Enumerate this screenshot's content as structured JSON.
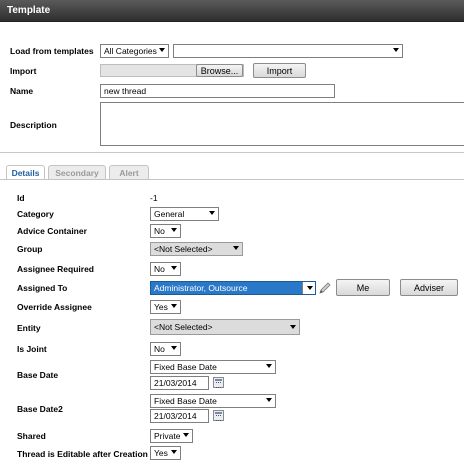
{
  "window": {
    "title": "Template"
  },
  "template": {
    "load_label": "Load from templates",
    "category_value": "All Categories",
    "template_value": "",
    "import_label": "Import",
    "browse_label": "Browse...",
    "import_button": "Import",
    "name_label": "Name",
    "name_value": "new thread",
    "description_label": "Description",
    "description_value": ""
  },
  "tabs": [
    {
      "label": "Details",
      "active": true
    },
    {
      "label": "Secondary",
      "active": false
    },
    {
      "label": "Alert",
      "active": false
    }
  ],
  "details": {
    "id_label": "Id",
    "id_value": "-1",
    "category_label": "Category",
    "category_value": "General",
    "advice_label": "Advice Container",
    "advice_value": "No",
    "group_label": "Group",
    "group_value": "<Not Selected>",
    "assignee_req_label": "Assignee Required",
    "assignee_req_value": "No",
    "assigned_to_label": "Assigned To",
    "assigned_to_value": "Administrator, Outsource",
    "me_button": "Me",
    "adviser_button": "Adviser",
    "override_label": "Override Assignee",
    "override_value": "Yes",
    "entity_label": "Entity",
    "entity_value": "<Not Selected>",
    "joint_label": "Is Joint",
    "joint_value": "No",
    "base_date_label": "Base Date",
    "base_date_type": "Fixed Base Date",
    "base_date_value": "21/03/2014",
    "base_date2_label": "Base Date2",
    "base_date2_type": "Fixed Base Date",
    "base_date2_value": "21/03/2014",
    "shared_label": "Shared",
    "shared_value": "Private",
    "editable_label": "Thread is Editable after Creation",
    "editable_value": "Yes"
  },
  "icons": [
    "pencil-icon",
    "calendar-icon",
    "chevron-down-icon"
  ],
  "colors": {
    "titlebar": "#3f3f3f",
    "selection": "#2a78c8",
    "active_tab": "#1f5fa0"
  }
}
